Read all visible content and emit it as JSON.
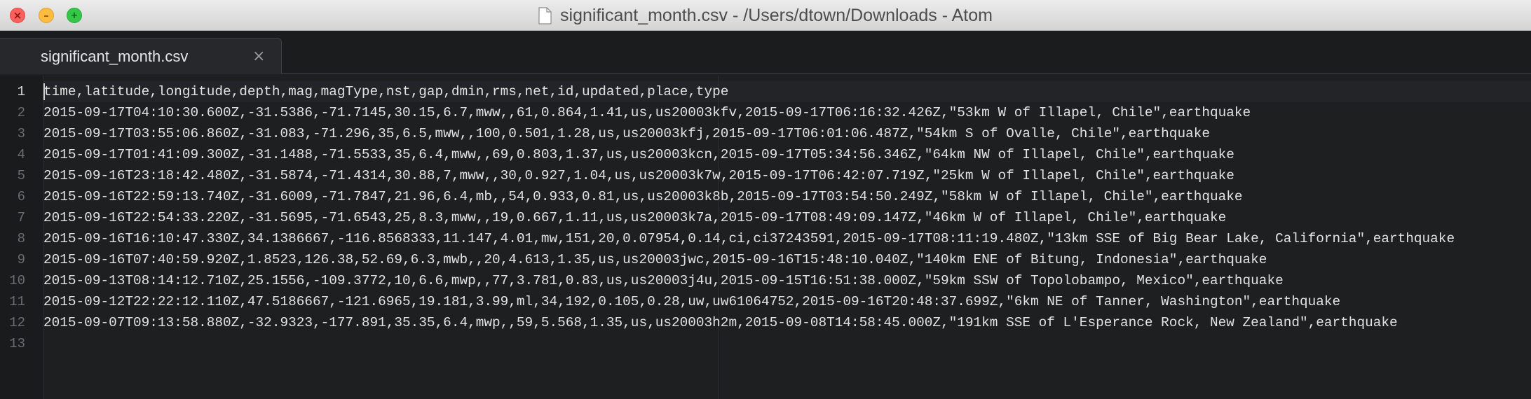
{
  "window": {
    "title": "significant_month.csv - /Users/dtown/Downloads - Atom"
  },
  "traffic_lights": {
    "close_glyph": "×",
    "minimize_glyph": "–",
    "zoom_glyph": "+"
  },
  "tab": {
    "label": "significant_month.csv",
    "close_glyph": "×"
  },
  "editor": {
    "line_numbers": [
      "1",
      "2",
      "3",
      "4",
      "5",
      "6",
      "7",
      "8",
      "9",
      "10",
      "11",
      "12",
      "13"
    ],
    "active_line": "1",
    "lines": [
      "time,latitude,longitude,depth,mag,magType,nst,gap,dmin,rms,net,id,updated,place,type",
      "2015-09-17T04:10:30.600Z,-31.5386,-71.7145,30.15,6.7,mww,,61,0.864,1.41,us,us20003kfv,2015-09-17T06:16:32.426Z,\"53km W of Illapel, Chile\",earthquake",
      "2015-09-17T03:55:06.860Z,-31.083,-71.296,35,6.5,mww,,100,0.501,1.28,us,us20003kfj,2015-09-17T06:01:06.487Z,\"54km S of Ovalle, Chile\",earthquake",
      "2015-09-17T01:41:09.300Z,-31.1488,-71.5533,35,6.4,mww,,69,0.803,1.37,us,us20003kcn,2015-09-17T05:34:56.346Z,\"64km NW of Illapel, Chile\",earthquake",
      "2015-09-16T23:18:42.480Z,-31.5874,-71.4314,30.88,7,mww,,30,0.927,1.04,us,us20003k7w,2015-09-17T06:42:07.719Z,\"25km W of Illapel, Chile\",earthquake",
      "2015-09-16T22:59:13.740Z,-31.6009,-71.7847,21.96,6.4,mb,,54,0.933,0.81,us,us20003k8b,2015-09-17T03:54:50.249Z,\"58km W of Illapel, Chile\",earthquake",
      "2015-09-16T22:54:33.220Z,-31.5695,-71.6543,25,8.3,mww,,19,0.667,1.11,us,us20003k7a,2015-09-17T08:49:09.147Z,\"46km W of Illapel, Chile\",earthquake",
      "2015-09-16T16:10:47.330Z,34.1386667,-116.8568333,11.147,4.01,mw,151,20,0.07954,0.14,ci,ci37243591,2015-09-17T08:11:19.480Z,\"13km SSE of Big Bear Lake, California\",earthquake",
      "2015-09-16T07:40:59.920Z,1.8523,126.38,52.69,6.3,mwb,,20,4.613,1.35,us,us20003jwc,2015-09-16T15:48:10.040Z,\"140km ENE of Bitung, Indonesia\",earthquake",
      "2015-09-13T08:14:12.710Z,25.1556,-109.3772,10,6.6,mwp,,77,3.781,0.83,us,us20003j4u,2015-09-15T16:51:38.000Z,\"59km SSW of Topolobampo, Mexico\",earthquake",
      "2015-09-12T22:22:12.110Z,47.5186667,-121.6965,19.181,3.99,ml,34,192,0.105,0.28,uw,uw61064752,2015-09-16T20:48:37.699Z,\"6km NE of Tanner, Washington\",earthquake",
      "2015-09-07T09:13:58.880Z,-32.9323,-177.891,35.35,6.4,mwp,,59,5.568,1.35,us,us20003h2m,2015-09-08T14:58:45.000Z,\"191km SSE of L'Esperance Rock, New Zealand\",earthquake",
      ""
    ]
  }
}
